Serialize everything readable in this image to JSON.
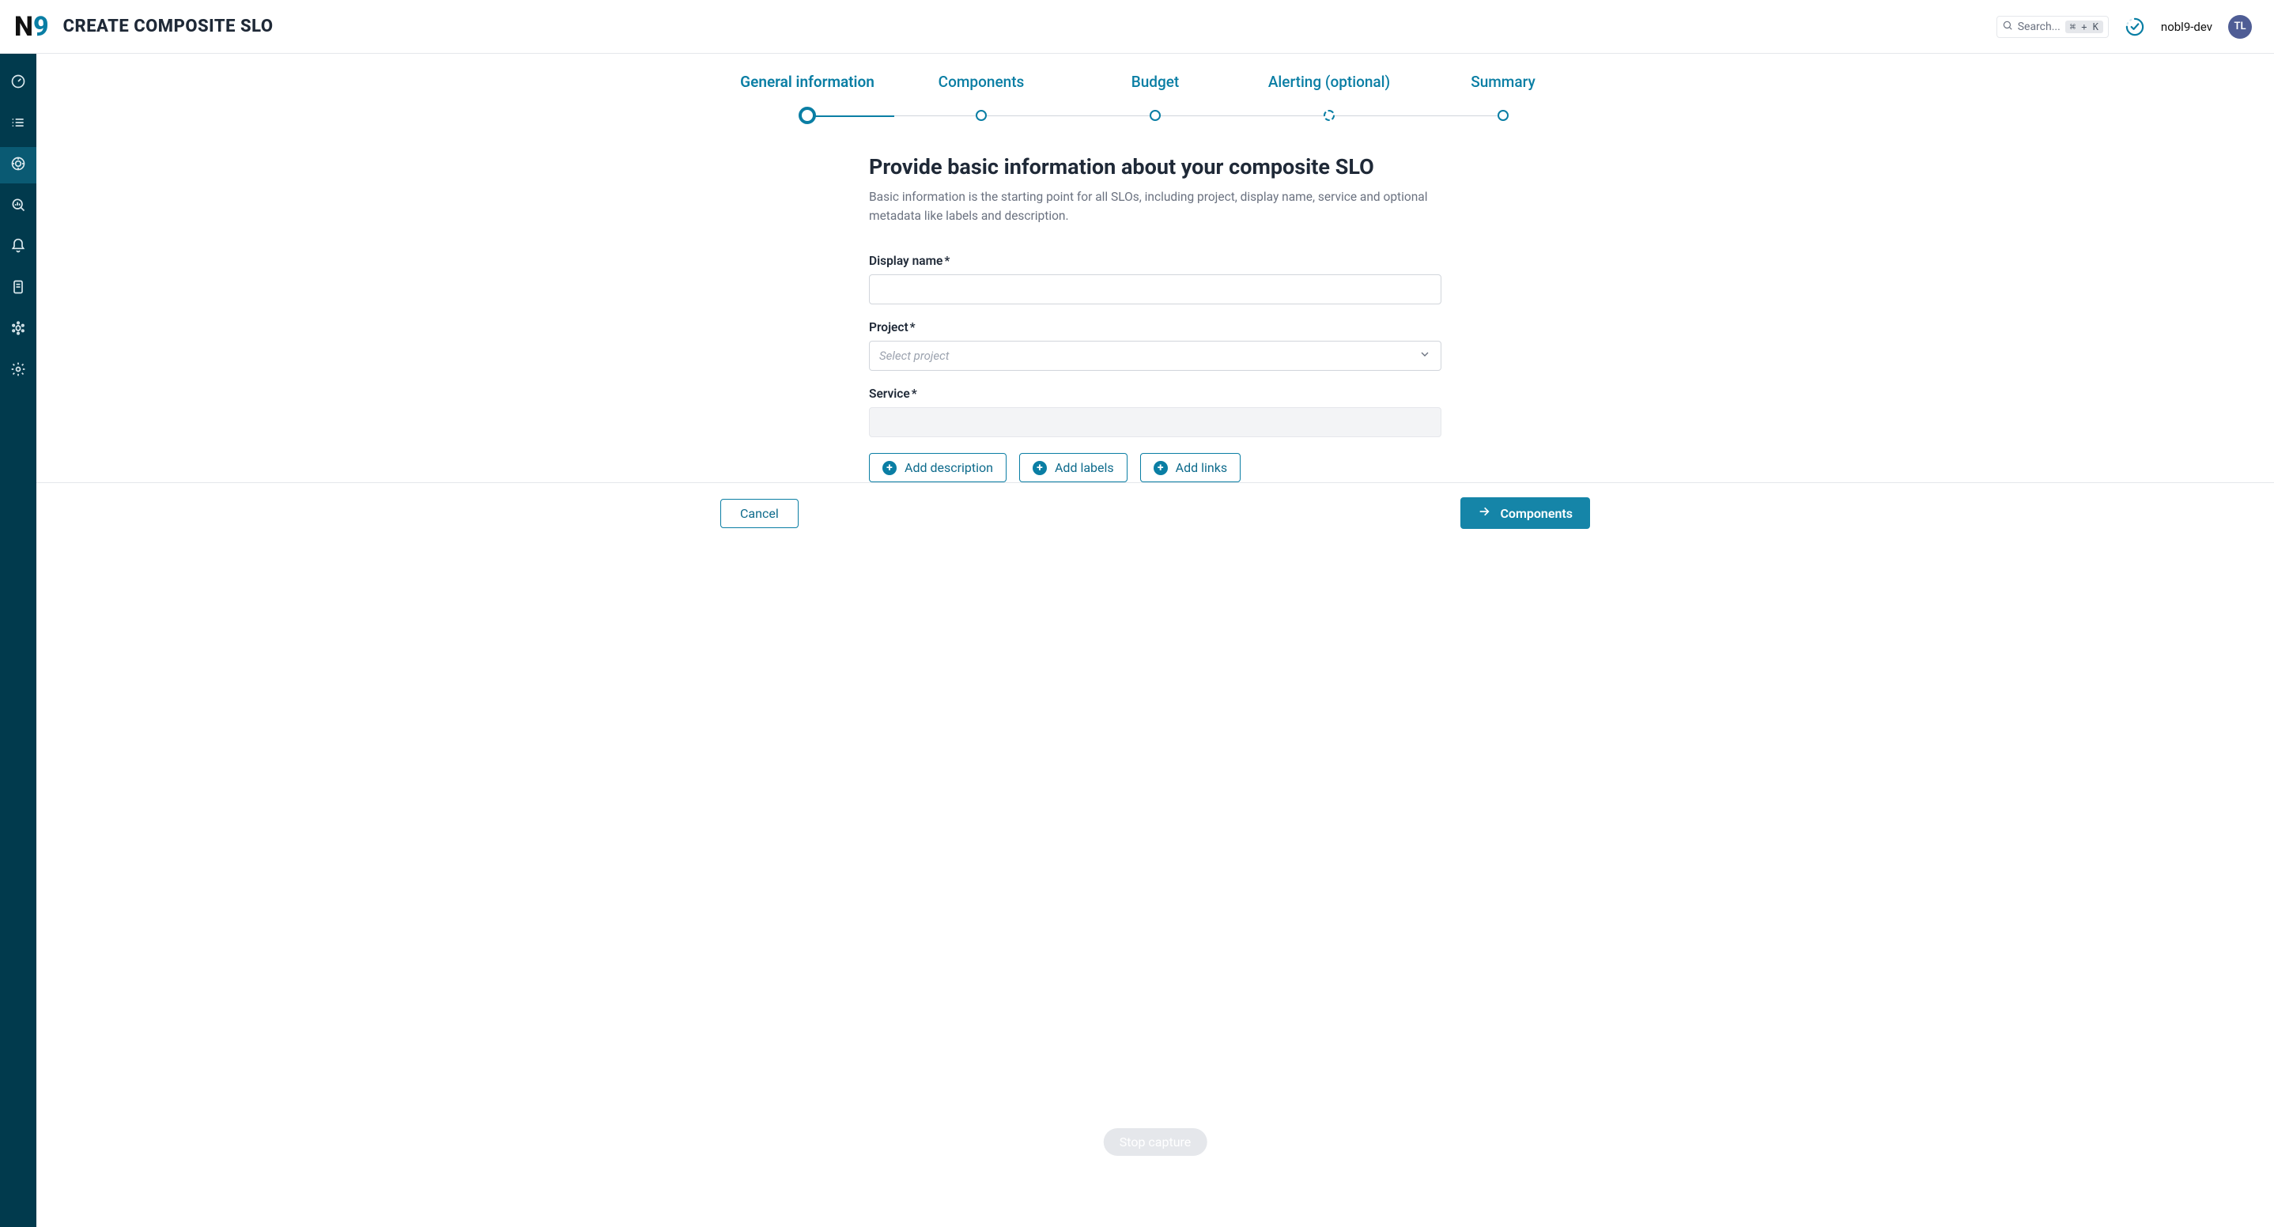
{
  "header": {
    "logo_text_prefix": "N",
    "logo_text_suffix": "9",
    "page_title": "CREATE COMPOSITE SLO",
    "search_placeholder": "Search...",
    "search_kbd": "⌘ + K",
    "org_name": "nobl9-dev",
    "avatar_initials": "TL"
  },
  "stepper": {
    "steps": [
      "General information",
      "Components",
      "Budget",
      "Alerting (optional)",
      "Summary"
    ]
  },
  "form": {
    "heading": "Provide basic information about your composite SLO",
    "subheading": "Basic information is the starting point for all SLOs, including project, display name, service and optional metadata like labels and description.",
    "display_name_label": "Display name",
    "display_name_value": "",
    "project_label": "Project",
    "project_placeholder": "Select project",
    "service_label": "Service",
    "required_mark": "*",
    "add_description": "Add description",
    "add_labels": "Add labels",
    "add_links": "Add links"
  },
  "chip": {
    "label": "Stop capture"
  },
  "footer": {
    "cancel": "Cancel",
    "next": "Components"
  }
}
